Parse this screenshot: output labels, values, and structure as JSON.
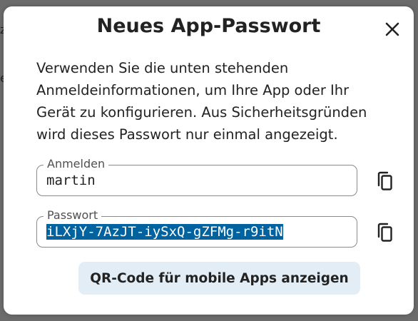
{
  "background": {
    "fragment_1": "z",
    "fragment_2": "e"
  },
  "dialog": {
    "title": "Neues App-Passwort",
    "close_icon": "close-icon",
    "description": "Verwenden Sie die unten stehenden Anmeldeinformationen, um Ihre App oder Ihr Gerät zu konfigurieren. Aus Sicherheitsgründen wird dieses Passwort nur einmal angezeigt.",
    "login_field": {
      "label": "Anmelden",
      "value": "martin",
      "copy_icon": "copy-icon"
    },
    "password_field": {
      "label": "Passwort",
      "value": "iLXjY-7AzJT-iySxQ-gZFMg-r9itN",
      "copy_icon": "copy-icon",
      "selected": true
    },
    "qr_button_label": "QR-Code für mobile Apps anzeigen"
  },
  "colors": {
    "selection": "#00629e",
    "qr_button_bg": "#e3edf5",
    "overlay": "#6b6b6b"
  }
}
